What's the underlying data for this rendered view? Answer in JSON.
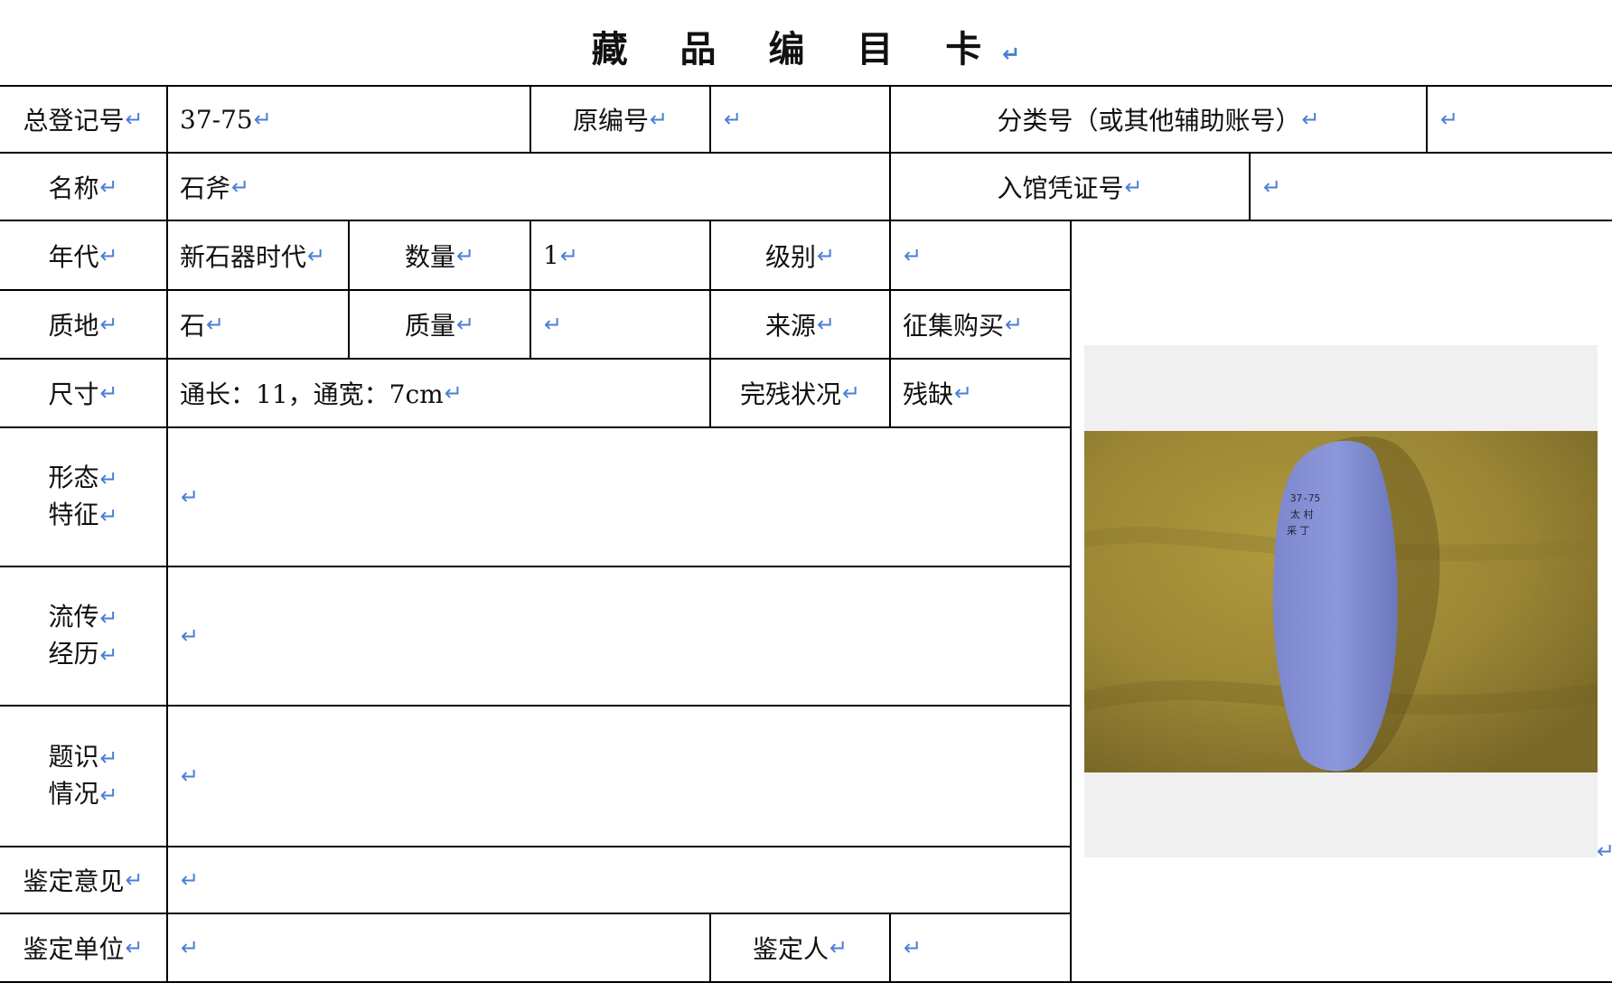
{
  "title": "藏 品 编 目 卡",
  "return_mark": "↵",
  "fields": {
    "reg_no": {
      "label": "总登记号",
      "value": "37-75"
    },
    "orig_no": {
      "label": "原编号",
      "value": ""
    },
    "class_no": {
      "label": "分类号（或其他辅助账号）",
      "value": ""
    },
    "name": {
      "label": "名称",
      "value": "石斧"
    },
    "voucher_no": {
      "label": "入馆凭证号",
      "value": ""
    },
    "era": {
      "label": "年代",
      "value": "新石器时代"
    },
    "quantity": {
      "label": "数量",
      "value": "1"
    },
    "grade": {
      "label": "级别",
      "value": ""
    },
    "material": {
      "label": "质地",
      "value": "石"
    },
    "mass": {
      "label": "质量",
      "value": ""
    },
    "source": {
      "label": "来源",
      "value": "征集购买"
    },
    "size": {
      "label": "尺寸",
      "value": "通长：11，通宽：7cm"
    },
    "condition": {
      "label": "完残状况",
      "value": "残缺"
    },
    "form": {
      "label_1": "形态",
      "label_2": "特征",
      "value": ""
    },
    "history": {
      "label_1": "流传",
      "label_2": "经历",
      "value": ""
    },
    "inscription": {
      "label_1": "题识",
      "label_2": "情况",
      "value": ""
    },
    "opinion": {
      "label": "鉴定意见",
      "value": ""
    },
    "unit": {
      "label": "鉴定单位",
      "value": ""
    },
    "appraiser": {
      "label": "鉴定人",
      "value": ""
    }
  },
  "photo": {
    "label_line1": "37-75",
    "label_line2": "太 村",
    "label_line3": "采 丁"
  }
}
